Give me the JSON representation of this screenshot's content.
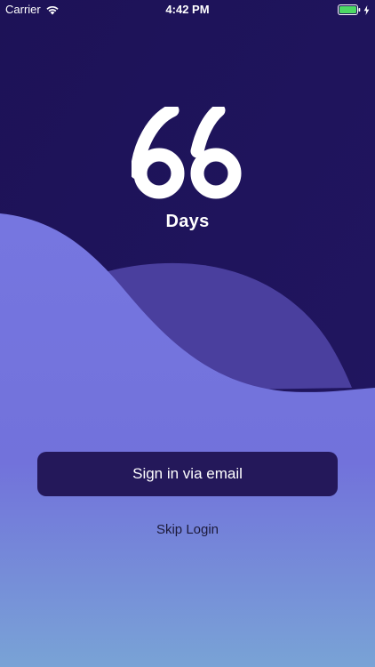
{
  "status_bar": {
    "carrier": "Carrier",
    "time": "4:42 PM",
    "wifi_icon": "wifi-icon",
    "battery_icon": "battery-full-icon",
    "charging_icon": "charging-bolt-icon",
    "battery_color": "#4cd964"
  },
  "brand": {
    "logo_icon": "66-days-logo",
    "app_name": "Days"
  },
  "actions": {
    "signin_label": "Sign in via email",
    "skip_label": "Skip Login"
  },
  "colors": {
    "background_top": "#1d1257",
    "wave_front": "#7474de",
    "wave_back": "#4a3f9e",
    "gradient_bottom": "#7aa3d6",
    "button_bg": "#24185a",
    "button_text": "#ffffff",
    "skip_text": "#1c1a3a"
  }
}
